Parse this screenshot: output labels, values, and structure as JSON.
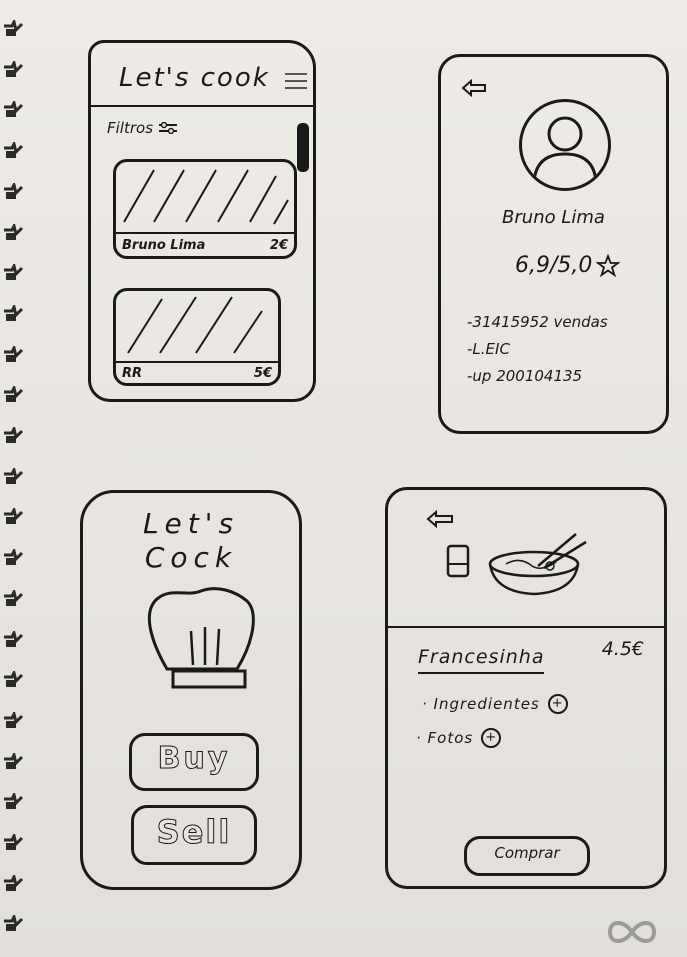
{
  "colors": {
    "ink": "#1a1a1a",
    "paper": "#e9e6e2"
  },
  "screen_list": {
    "app_title": "Let's cook",
    "filters_label": "Filtros",
    "items": [
      {
        "seller": "Bruno Lima",
        "price": "2€"
      },
      {
        "seller": "RR",
        "price": "5€"
      }
    ]
  },
  "screen_profile": {
    "name": "Bruno Lima",
    "rating": "6,9/5,0",
    "stats": [
      "-31415952 vendas",
      "-L.EIC",
      "-up 200104135"
    ]
  },
  "screen_home": {
    "title_line1": "Let's",
    "title_line2": "Cock",
    "buy_label": "Buy",
    "sell_label": "Sell"
  },
  "screen_dish": {
    "name": "Francesinha",
    "price": "4.5€",
    "ingredients_label": "Ingredientes",
    "photos_label": "Fotos",
    "buy_label": "Comprar"
  },
  "icons": [
    "menu-icon",
    "filter-icon",
    "back-arrow-icon",
    "user-avatar-icon",
    "star-icon",
    "chef-hat-icon",
    "glass-icon",
    "bowl-chopsticks-icon",
    "plus-icon",
    "infinity-logo"
  ]
}
